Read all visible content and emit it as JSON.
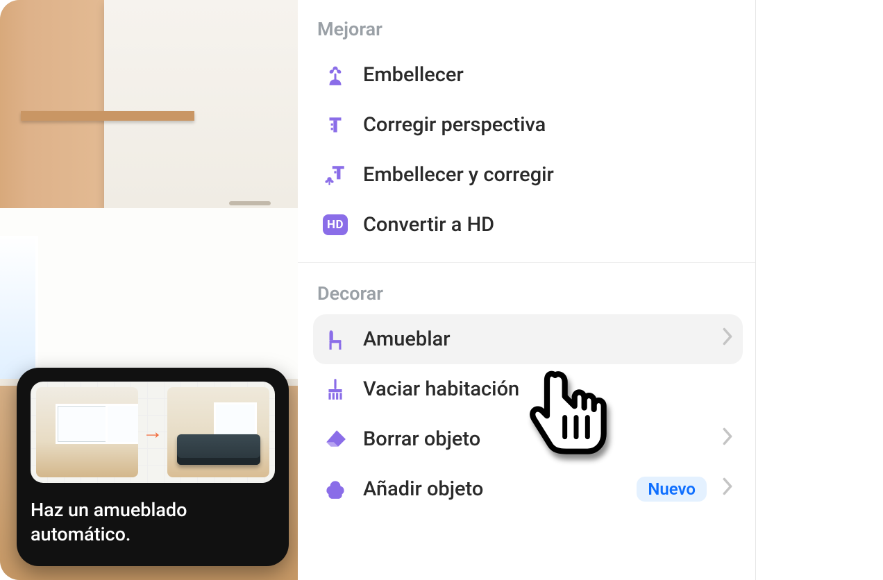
{
  "tooltip": {
    "text": "Haz un amueblado automático.",
    "arrow": "→"
  },
  "sections": {
    "improve": {
      "title": "Mejorar",
      "items": {
        "beautify": "Embellecer",
        "perspective": "Corregir perspectiva",
        "beautify_fix": "Embellecer y corregir",
        "hd": "Convertir a HD",
        "hd_badge": "HD"
      }
    },
    "decorate": {
      "title": "Decorar",
      "items": {
        "furnish": "Amueblar",
        "empty_room": "Vaciar habitación",
        "erase_object": "Borrar objeto",
        "add_object": "Añadir objeto",
        "add_object_badge": "Nuevo"
      }
    }
  },
  "colors": {
    "accent": "#8a6de8",
    "badge_bg": "#e4f1ff",
    "badge_text": "#0f6fff"
  }
}
